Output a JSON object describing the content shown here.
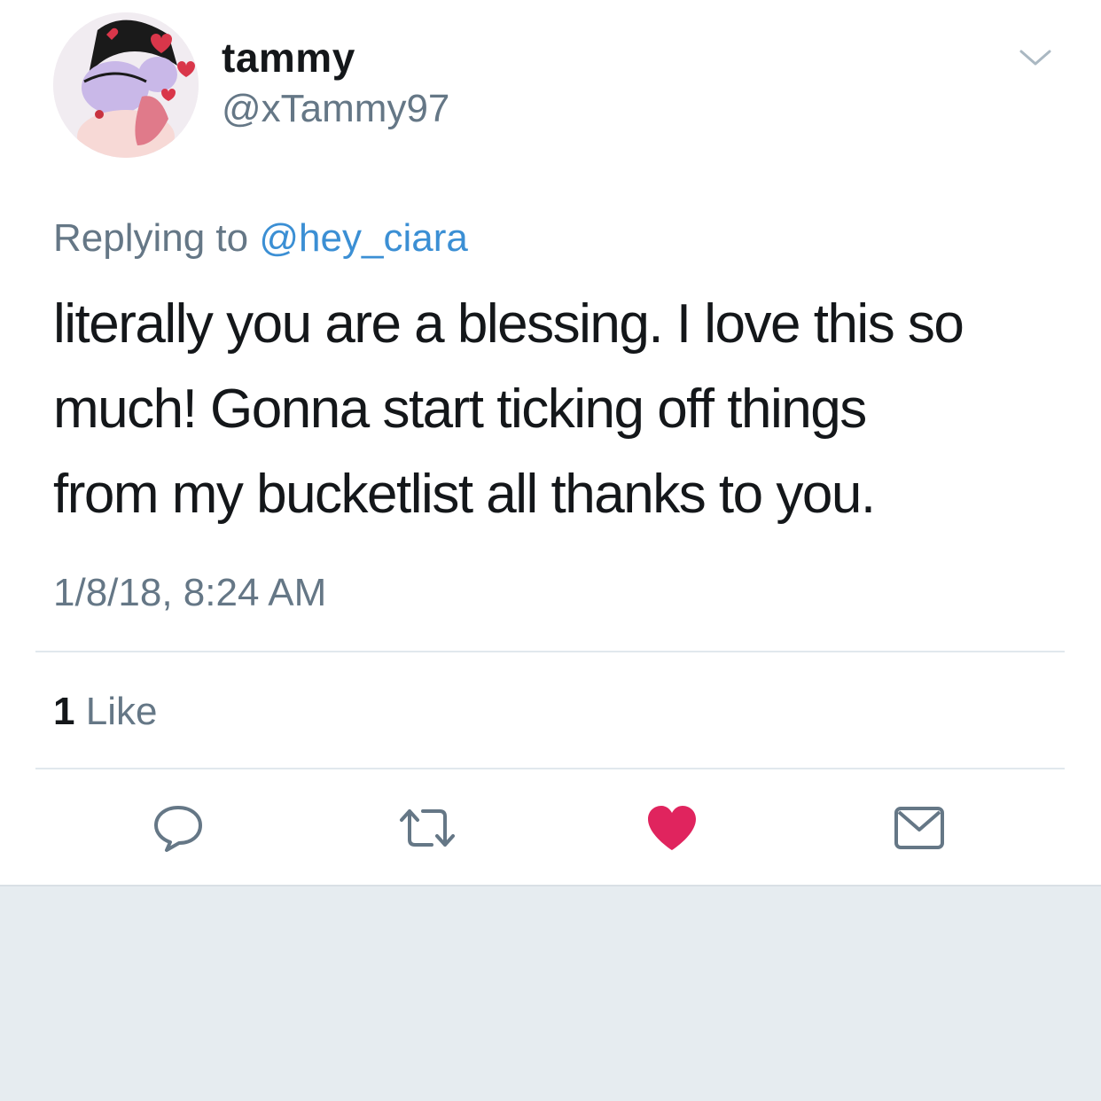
{
  "author": {
    "display_name": "tammy",
    "handle": "@xTammy97"
  },
  "reply_context": {
    "prefix": "Replying to",
    "mention": "@hey_ciara"
  },
  "tweet": {
    "lines": [
      "literally you are a blessing. I love this so",
      "much! Gonna start ticking off things",
      "from my bucketlist all thanks to you."
    ],
    "timestamp": "1/8/18, 8:24 AM"
  },
  "stats": {
    "like_count": "1",
    "like_label": "Like"
  },
  "actions": [
    {
      "icon": "reply-icon"
    },
    {
      "icon": "retweet-icon"
    },
    {
      "icon": "heart-icon",
      "liked": true
    },
    {
      "icon": "direct-message-icon"
    }
  ],
  "colors": {
    "text": "#14171a",
    "secondary": "#657786",
    "link": "#3b8fd4",
    "like": "#e0245e",
    "divider": "#e1e8ed",
    "background_below": "#e6ecf0"
  }
}
